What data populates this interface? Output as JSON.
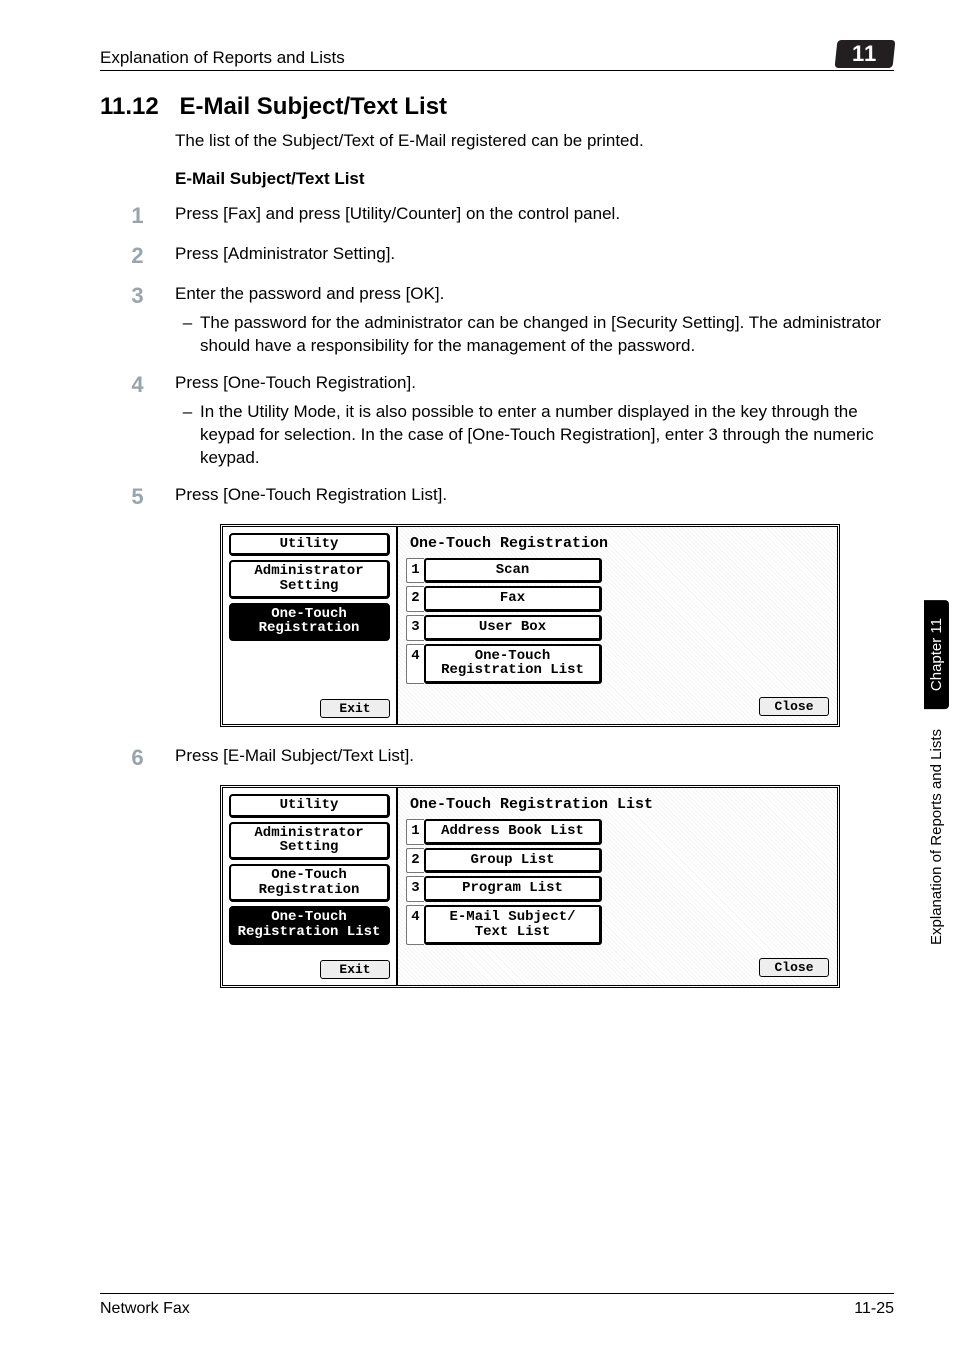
{
  "header": {
    "breadcrumb": "Explanation of Reports and Lists",
    "chapter_badge": "11"
  },
  "section": {
    "number": "11.12",
    "title": "E-Mail Subject/Text List",
    "intro": "The list of the Subject/Text of E-Mail registered can be printed.",
    "subheading": "E-Mail Subject/Text List"
  },
  "steps": [
    {
      "n": "1",
      "text": "Press [Fax] and press [Utility/Counter] on the control panel."
    },
    {
      "n": "2",
      "text": "Press [Administrator Setting]."
    },
    {
      "n": "3",
      "text": "Enter the password and press [OK].",
      "sub": "The password for the administrator can be changed in [Security Setting]. The administrator should have a responsibility for the management of the password."
    },
    {
      "n": "4",
      "text": "Press [One-Touch Registration].",
      "sub": "In the Utility Mode, it is also possible to enter a number displayed in the key through the keypad for selection. In the case of [One-Touch Registration], enter 3 through the numeric keypad."
    },
    {
      "n": "5",
      "text": "Press [One-Touch Registration List]."
    },
    {
      "n": "6",
      "text": "Press [E-Mail Subject/Text List]."
    }
  ],
  "panelA": {
    "left": {
      "utility": "Utility",
      "admin": "Administrator\nSetting",
      "active": "One-Touch\nRegistration",
      "exit": "Exit"
    },
    "title": "One-Touch Registration",
    "items": [
      {
        "n": "1",
        "label": "Scan"
      },
      {
        "n": "2",
        "label": "Fax"
      },
      {
        "n": "3",
        "label": "User Box"
      },
      {
        "n": "4",
        "label": "One-Touch\nRegistration List"
      }
    ],
    "close": "Close"
  },
  "panelB": {
    "left": {
      "utility": "Utility",
      "admin": "Administrator\nSetting",
      "onetouch": "One-Touch\nRegistration",
      "active": "One-Touch\nRegistration List",
      "exit": "Exit"
    },
    "title": "One-Touch Registration List",
    "items": [
      {
        "n": "1",
        "label": "Address Book List"
      },
      {
        "n": "2",
        "label": "Group List"
      },
      {
        "n": "3",
        "label": "Program List"
      },
      {
        "n": "4",
        "label": "E-Mail Subject/\nText List"
      }
    ],
    "close": "Close"
  },
  "sidebar": {
    "chapter": "Chapter 11",
    "title": "Explanation of Reports and Lists"
  },
  "footer": {
    "left": "Network Fax",
    "right": "11-25"
  }
}
